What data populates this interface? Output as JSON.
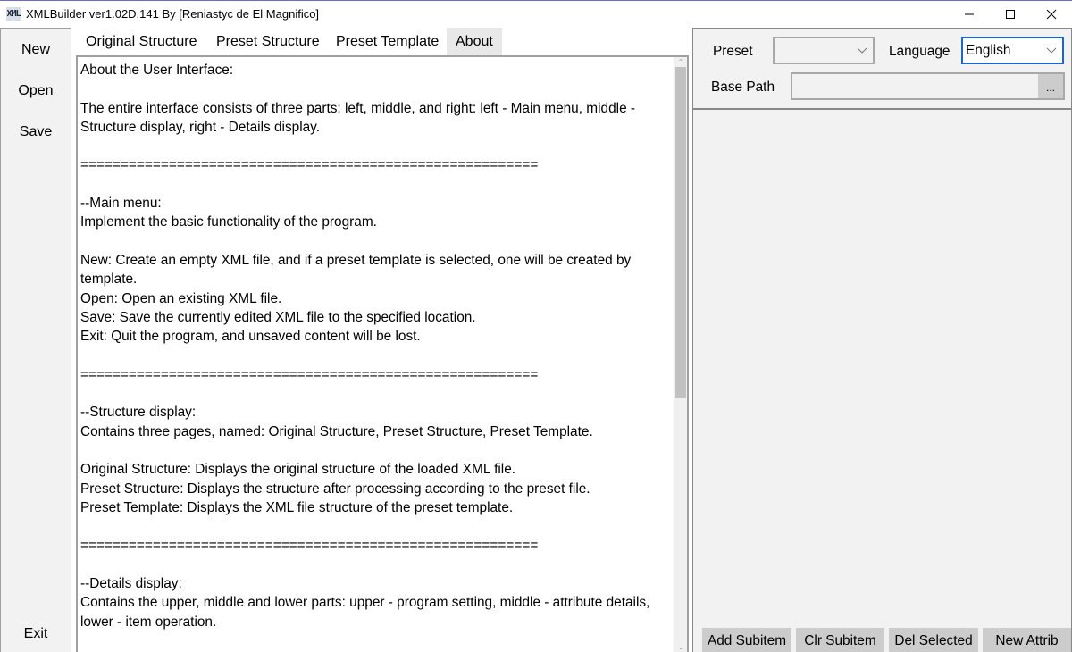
{
  "window": {
    "title": "XMLBuilder ver1.02D.141 By [Reniastyc de El Magnifico]",
    "app_icon_text": "XML",
    "controls": {
      "minimize": "minimize-icon",
      "maximize": "maximize-icon",
      "close": "close-icon"
    }
  },
  "main_menu": {
    "items": [
      {
        "label": "New"
      },
      {
        "label": "Open"
      },
      {
        "label": "Save"
      },
      {
        "label": "Exit"
      }
    ]
  },
  "structure_display": {
    "tabs": [
      {
        "label": "Original Structure",
        "active": false
      },
      {
        "label": "Preset Structure",
        "active": false
      },
      {
        "label": "Preset Template",
        "active": false
      },
      {
        "label": "About",
        "active": true
      }
    ],
    "about_text": "About the User Interface:\n\nThe entire interface consists of three parts: left, middle, and right: left - Main menu, middle - Structure display, right - Details display.\n\n=========================================================\n\n--Main menu:\nImplement the basic functionality of the program.\n\nNew: Create an empty XML file, and if a preset template is selected, one will be created by template.\nOpen: Open an existing XML file.\nSave: Save the currently edited XML file to the specified location.\nExit: Quit the program, and unsaved content will be lost.\n\n=========================================================\n\n--Structure display:\nContains three pages, named: Original Structure, Preset Structure, Preset Template.\n\nOriginal Structure: Displays the original structure of the loaded XML file.\nPreset Structure: Displays the structure after processing according to the preset file.\nPreset Template: Displays the XML file structure of the preset template.\n\n=========================================================\n\n--Details display:\nContains the upper, middle and lower parts: upper - program setting, middle - attribute details, lower - item operation.",
    "scroll_position_fraction": 0.0,
    "scroll_visible_fraction": 0.56
  },
  "details_display": {
    "settings": {
      "preset_label": "Preset",
      "preset_value": "",
      "language_label": "Language",
      "language_value": "English",
      "base_path_label": "Base Path",
      "base_path_value": "",
      "browse_label": "..."
    },
    "operations": [
      {
        "label": "Add Subitem"
      },
      {
        "label": "Clr Subitem"
      },
      {
        "label": "Del Selected"
      },
      {
        "label": "New Attrib"
      }
    ]
  },
  "colors": {
    "focus_border": "#1d64d0",
    "panel_bg": "#f2f2f2",
    "button_bg": "#cccccc",
    "active_tab_bg": "#e8e8e8"
  }
}
